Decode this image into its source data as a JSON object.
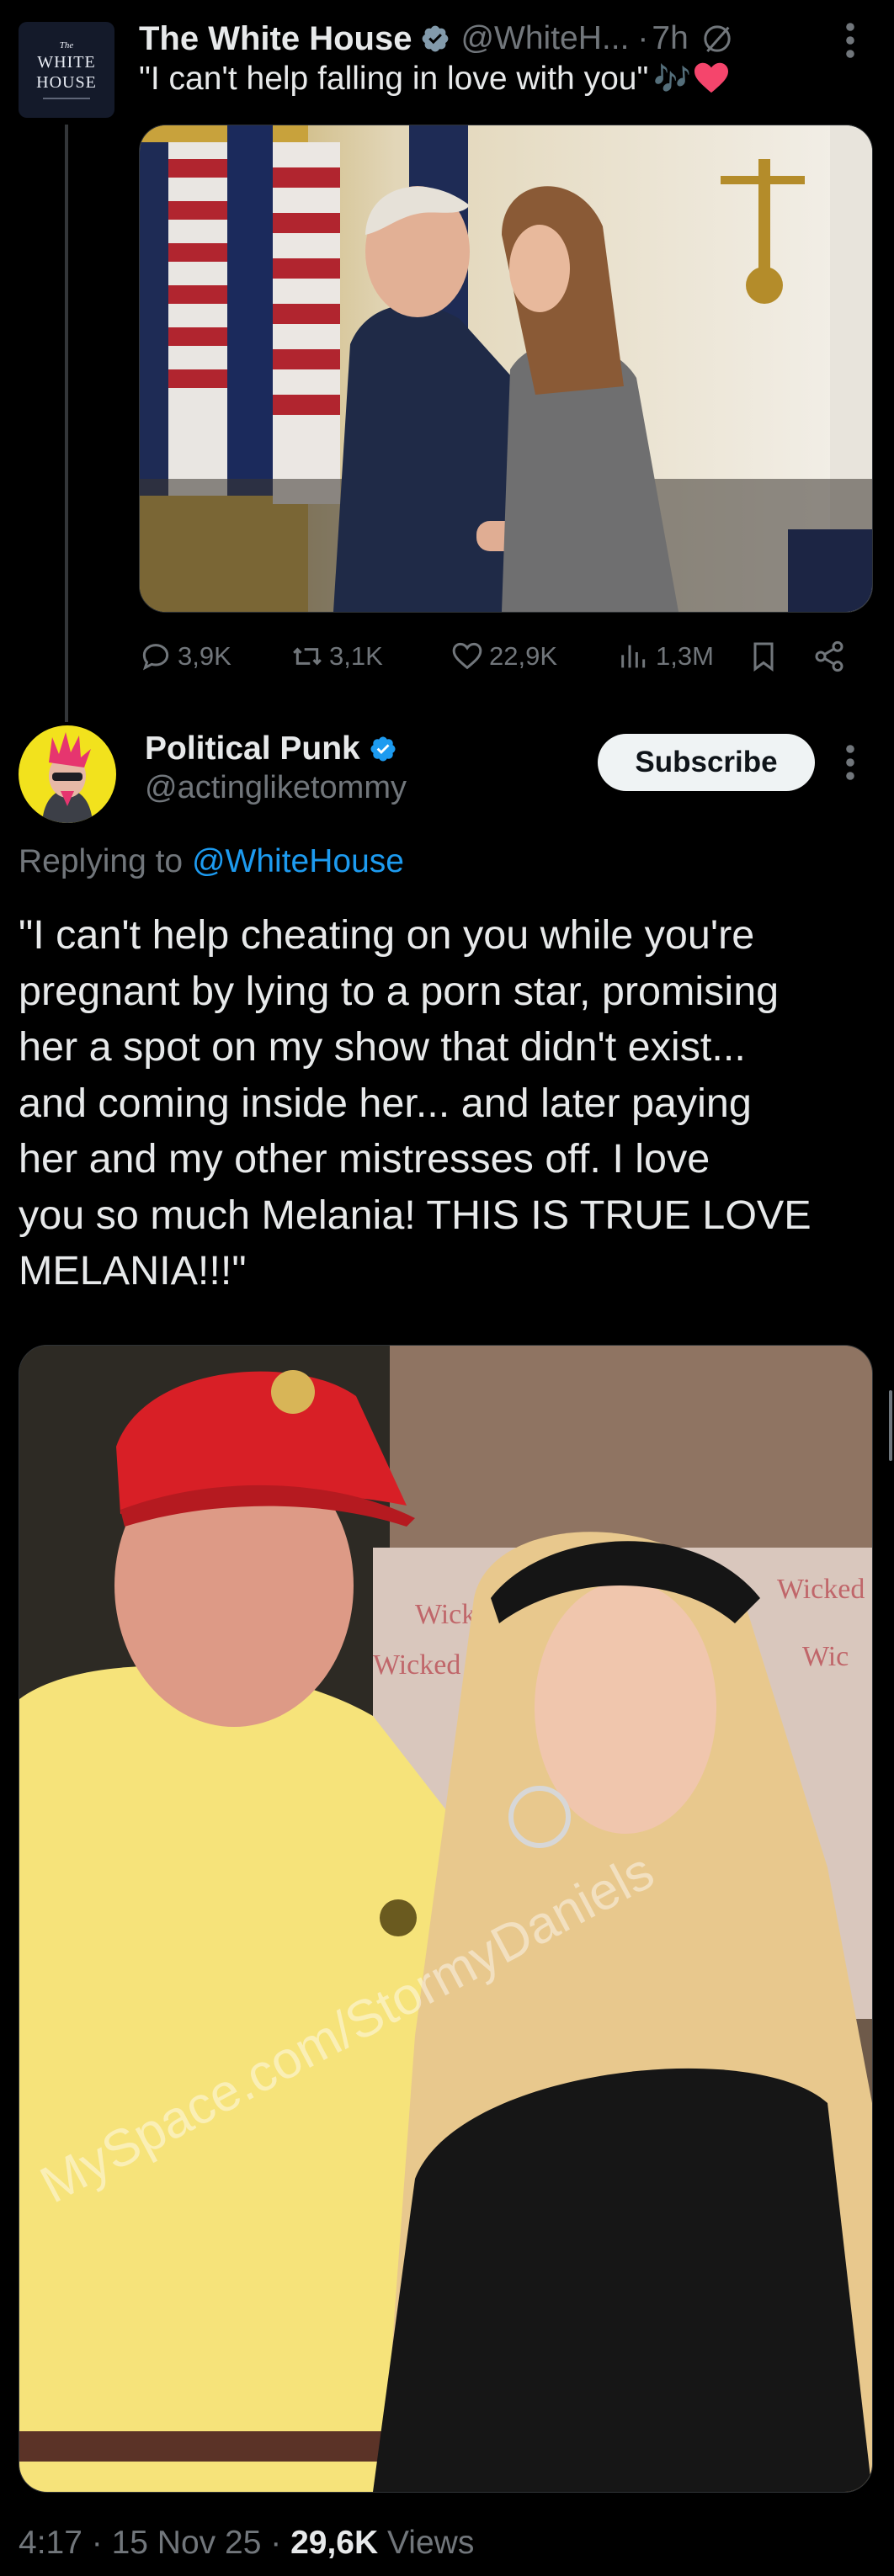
{
  "tweet1": {
    "author_name": "The White House",
    "handle": "@WhiteH...",
    "separator": "·",
    "time": "7h",
    "text": "\"I can't help falling in love with you\"",
    "emoji_note": "🎶",
    "avatar": {
      "small": "The",
      "line1": "WHITE",
      "line2": "HOUSE"
    },
    "stats": {
      "replies": "3,9K",
      "reposts": "3,1K",
      "likes": "22,9K",
      "views": "1,3M"
    }
  },
  "reply": {
    "author_name": "Political Punk",
    "handle": "@actingliketommy",
    "subscribe_label": "Subscribe",
    "replying_prefix": "Replying to",
    "replying_to": "@WhiteHouse",
    "text_lines": [
      "\"I can't help cheating on you while you're",
      "pregnant by lying to a porn star, promising",
      "her a spot on my show that didn't exist...",
      "and coming inside her... and later paying",
      "her and my other mistresses off. I love",
      "you so much Melania! THIS IS TRUE LOVE",
      "MELANIA!!!\""
    ],
    "watermark": "MySpace.com/StormyDaniels",
    "meta": {
      "time": "4:17",
      "sep1": "·",
      "date": "15 Nov 25",
      "sep2": "·",
      "views_count": "29,6K",
      "views_label": "Views"
    }
  },
  "colors": {
    "background": "#000000",
    "text_primary": "#e7e9ea",
    "text_secondary": "#71767b",
    "accent_blue": "#1d9bf0",
    "verified_badge": "#829aab",
    "divider": "#333639"
  },
  "icons": {
    "verified": "verified-badge-icon",
    "grok": "grok-icon",
    "more": "more-vertical-icon",
    "reply": "reply-icon",
    "repost": "repost-icon",
    "like": "heart-icon",
    "views": "views-chart-icon",
    "bookmark": "bookmark-icon",
    "share": "share-icon"
  }
}
